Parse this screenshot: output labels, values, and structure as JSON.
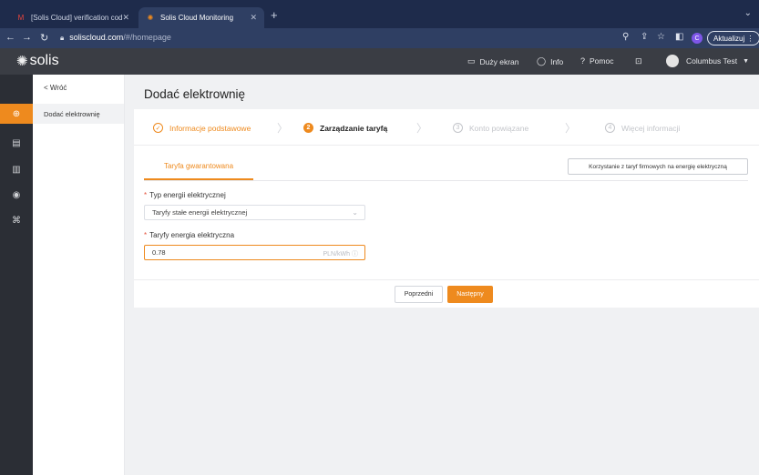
{
  "browser": {
    "tabs": [
      {
        "title": "[Solis Cloud] verification cod",
        "favicon": "gmail-icon"
      },
      {
        "title": "Solis Cloud Monitoring",
        "favicon": "solis-icon"
      }
    ],
    "url_host": "soliscloud.com",
    "url_path": "/#/homepage",
    "profile_initial": "C",
    "update_label": "Aktualizuj"
  },
  "header": {
    "logo_text": "solis",
    "items": [
      {
        "label": "Duży ekran",
        "icon": "monitor-icon"
      },
      {
        "label": "Info",
        "icon": "chat-icon"
      },
      {
        "label": "Pomoc",
        "icon": "help-icon"
      }
    ],
    "user_name": "Columbus Test"
  },
  "subnav": {
    "back_label": "< Wróć",
    "items": [
      {
        "label": "Dodać elektrownię",
        "active": true
      }
    ]
  },
  "page": {
    "title": "Dodać elektrownię",
    "steps": [
      {
        "number": "✓",
        "label": "Informacje podstawowe",
        "state": "done"
      },
      {
        "number": "2",
        "label": "Zarządzanie taryfą",
        "state": "current"
      },
      {
        "number": "3",
        "label": "Konto powiązane",
        "state": "todo"
      },
      {
        "number": "4",
        "label": "Więcej informacji",
        "state": "todo"
      }
    ],
    "tariff_tab": "Taryfa gwarantowana",
    "commercial_button": "Korzystanie z taryf firmowych na energię elektryczną",
    "energy_type_label": "Typ energii elektrycznej",
    "energy_type_value": "Taryfy stałe energii elektrycznej",
    "tariff_label": "Taryfy energia elektryczna",
    "tariff_value": "0.78",
    "tariff_unit": "PLN/kWh",
    "prev_button": "Poprzedni",
    "next_button": "Następny"
  },
  "colors": {
    "accent": "#ee8a1e",
    "header_bg": "#3a3d44",
    "rail_bg": "#2b2e35"
  }
}
